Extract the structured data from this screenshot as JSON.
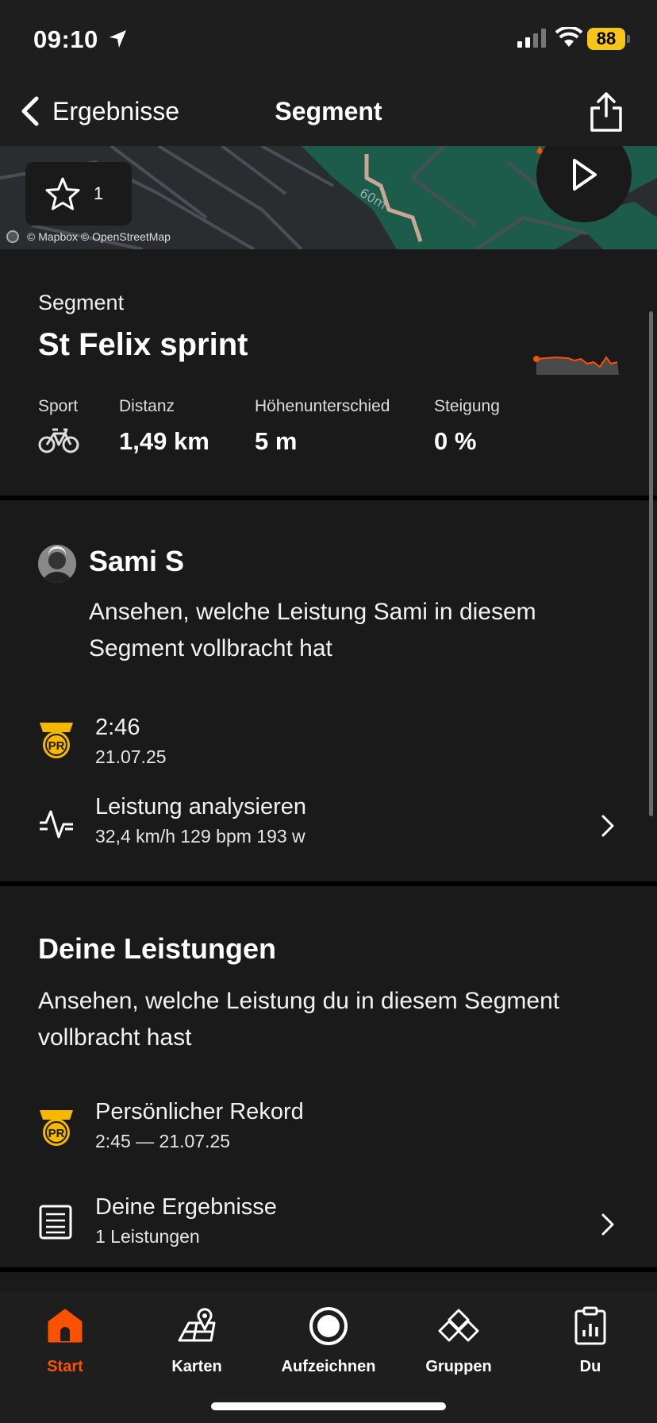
{
  "status_bar": {
    "time": "09:10",
    "battery": "88"
  },
  "nav": {
    "back_label": "Ergebnisse",
    "title": "Segment"
  },
  "map": {
    "favorites_count": "1",
    "attribution": "© Mapbox © OpenStreetMap",
    "road_label": "60m"
  },
  "segment": {
    "label": "Segment",
    "name": "St Felix sprint",
    "stats": [
      {
        "label": "Sport",
        "value": "",
        "icon": "bike-icon"
      },
      {
        "label": "Distanz",
        "value": "1,49 km"
      },
      {
        "label": "Höhenunterschied",
        "value": "5 m"
      },
      {
        "label": "Steigung",
        "value": "0 %"
      }
    ]
  },
  "athlete": {
    "name": "Sami  S",
    "description": "Ansehen, welche Leistung Sami in diesem Segment vollbracht hat",
    "pr_time": "2:46",
    "pr_date": "21.07.25",
    "analyze_title": "Leistung analysieren",
    "analyze_stats": "32,4 km/h 129 bpm 193 w"
  },
  "your_efforts": {
    "title": "Deine Leistungen",
    "description": "Ansehen, welche Leistung du in diesem Segment vollbracht hast",
    "pr_title": "Persönlicher Rekord",
    "pr_sub": "2:45 — 21.07.25",
    "results_title": "Deine Ergebnisse",
    "results_sub": "1 Leistungen"
  },
  "tabs": [
    {
      "label": "Start",
      "icon": "home-icon",
      "active": true
    },
    {
      "label": "Karten",
      "icon": "maps-icon"
    },
    {
      "label": "Aufzeichnen",
      "icon": "record-icon"
    },
    {
      "label": "Gruppen",
      "icon": "groups-icon"
    },
    {
      "label": "Du",
      "icon": "you-icon"
    }
  ],
  "colors": {
    "accent": "#fc5200",
    "pr_gold": "#f5b800",
    "background": "#121212",
    "card": "#1a1a1a"
  }
}
